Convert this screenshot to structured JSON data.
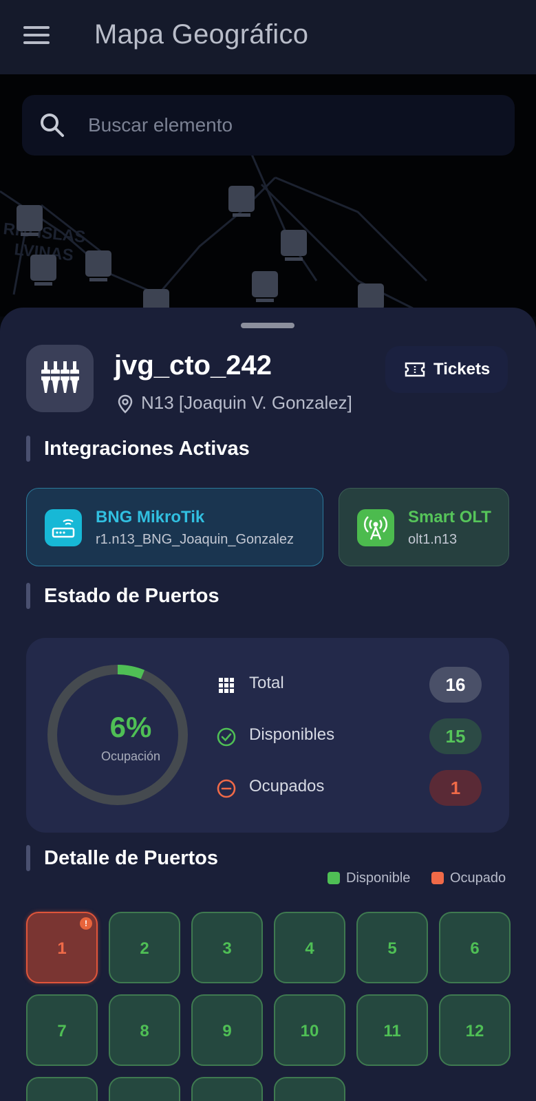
{
  "appbar": {
    "title": "Mapa Geográfico"
  },
  "search": {
    "placeholder": "Buscar elemento"
  },
  "map": {
    "labels": [
      "RIO ISLAS",
      "LVINAS"
    ]
  },
  "element": {
    "name": "jvg_cto_242",
    "location": "N13 [Joaquin V. Gonzalez]",
    "tickets_label": "Tickets"
  },
  "integrations": {
    "title": "Integraciones Activas",
    "items": [
      {
        "name": "BNG MikroTik",
        "detail": "r1.n13_BNG_Joaquin_Gonzalez",
        "icon": "router-icon",
        "color": "#17b8d6"
      },
      {
        "name": "Smart OLT",
        "detail": "olt1.n13",
        "icon": "antenna-icon",
        "color": "#4cbb4e"
      }
    ]
  },
  "ports_status": {
    "title": "Estado de Puertos",
    "occupancy_percent": "6%",
    "occupancy_fraction": 0.0625,
    "occupancy_label": "Ocupación",
    "rows": [
      {
        "label": "Total",
        "value": "16",
        "icon": "grid-icon"
      },
      {
        "label": "Disponibles",
        "value": "15",
        "icon": "check-circle-icon"
      },
      {
        "label": "Ocupados",
        "value": "1",
        "icon": "minus-circle-icon"
      }
    ]
  },
  "ports_detail": {
    "title": "Detalle de Puertos",
    "legend_available": "Disponible",
    "legend_occupied": "Ocupado",
    "colors": {
      "available": "#4fbf55",
      "occupied": "#f06a48"
    },
    "ports": [
      {
        "number": "1",
        "status": "occupied"
      },
      {
        "number": "2",
        "status": "available"
      },
      {
        "number": "3",
        "status": "available"
      },
      {
        "number": "4",
        "status": "available"
      },
      {
        "number": "5",
        "status": "available"
      },
      {
        "number": "6",
        "status": "available"
      },
      {
        "number": "7",
        "status": "available"
      },
      {
        "number": "8",
        "status": "available"
      },
      {
        "number": "9",
        "status": "available"
      },
      {
        "number": "10",
        "status": "available"
      },
      {
        "number": "11",
        "status": "available"
      },
      {
        "number": "12",
        "status": "available"
      },
      {
        "number": "",
        "status": "available"
      },
      {
        "number": "",
        "status": "available"
      },
      {
        "number": "",
        "status": "available"
      },
      {
        "number": "",
        "status": "available"
      }
    ]
  }
}
